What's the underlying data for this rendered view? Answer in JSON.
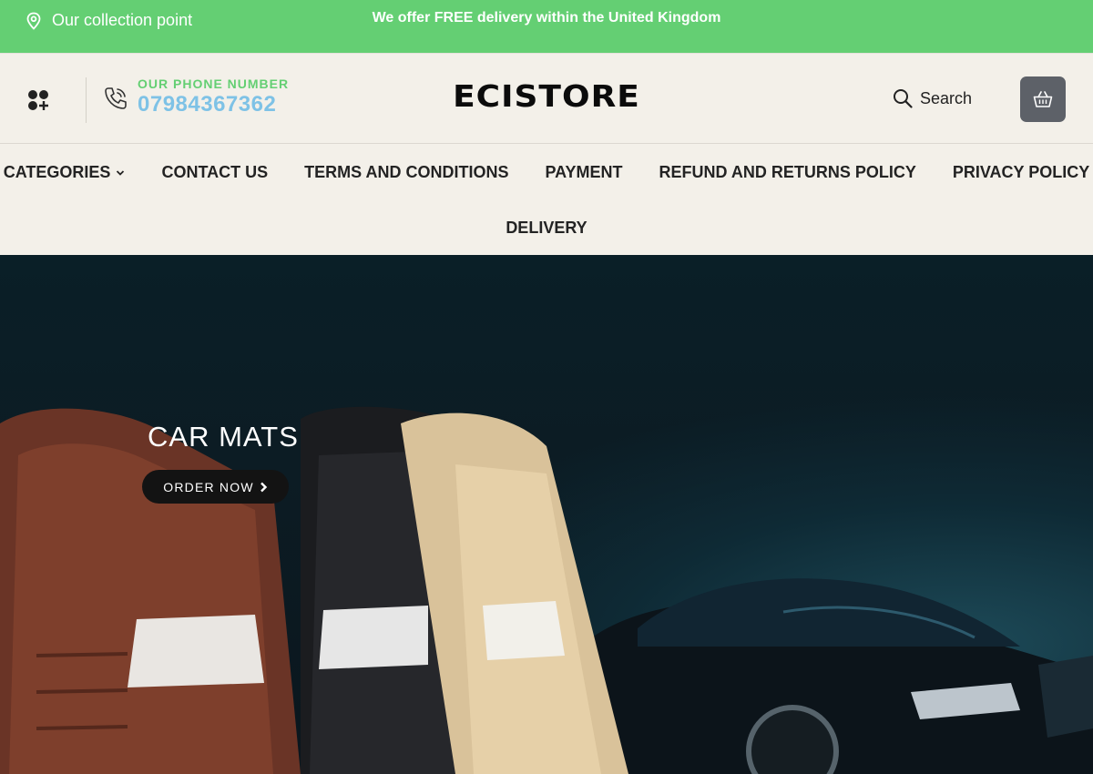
{
  "topbar": {
    "collection_label": "Our collection point",
    "announcement": "We offer FREE delivery within the United Kingdom",
    "background_color": "#64cf73"
  },
  "header": {
    "phone_label": "OUR PHONE NUMBER",
    "phone_number": "07984367362",
    "logo": "ECISTORE",
    "search_label": "Search",
    "icons": [
      "menu-grid-icon",
      "phone-icon",
      "search-icon",
      "basket-icon"
    ]
  },
  "nav": {
    "items": [
      {
        "label": "CATEGORIES"
      },
      {
        "label": "CONTACT US"
      },
      {
        "label": "TERMS AND CONDITIONS"
      },
      {
        "label": "PAYMENT"
      },
      {
        "label": "REFUND AND RETURNS POLICY"
      },
      {
        "label": "PRIVACY POLICY"
      },
      {
        "label": "DELIVERY"
      }
    ]
  },
  "hero": {
    "title": "CAR MATS",
    "button_label": "ORDER NOW"
  }
}
